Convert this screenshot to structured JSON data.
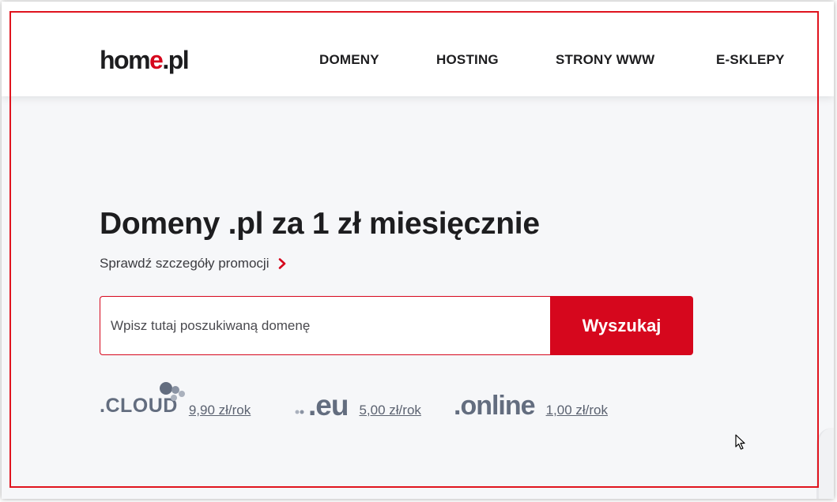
{
  "header": {
    "logo": {
      "main": "hom",
      "accent": "e",
      "tail": ".pl"
    },
    "nav": [
      "DOMENY",
      "HOSTING",
      "STRONY WWW",
      "E-SKLEPY"
    ]
  },
  "hero": {
    "headline": "Domeny .pl za 1 zł miesięcznie",
    "promo_link": "Sprawdź szczegóły promocji",
    "search": {
      "placeholder": "Wpisz tutaj poszukiwaną domenę",
      "value": "",
      "button_label": "Wyszukaj"
    },
    "tlds": [
      {
        "logo": ".CLOUD",
        "price": "9,90 zł/rok"
      },
      {
        "logo": ".eu",
        "price": "5,00 zł/rok"
      },
      {
        "logo": ".online",
        "price": "1,00 zł/rok"
      }
    ]
  },
  "colors": {
    "brand_red": "#d6071d",
    "text_dark": "#1d1d1f",
    "tld_gray": "#636d7f",
    "hero_bg": "#f6f7f9"
  }
}
